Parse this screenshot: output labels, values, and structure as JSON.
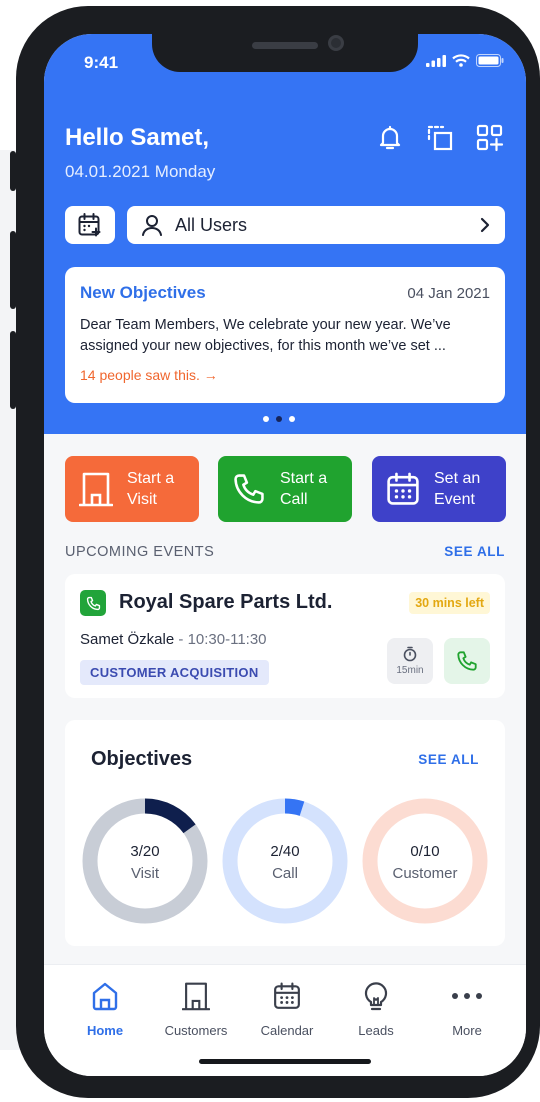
{
  "status": {
    "time": "9:41"
  },
  "header": {
    "greeting": "Hello Samet,",
    "date": "04.01.2021 Monday",
    "user_filter": "All Users"
  },
  "announcement": {
    "title": "New Objectives",
    "date": "04 Jan 2021",
    "body": "Dear Team Members, We celebrate your new year. We’ve assigned your new objectives, for this month we’ve set ...",
    "seen": "14 people saw this.",
    "carousel_pages": 3,
    "active_page": 1
  },
  "quick_actions": [
    {
      "label": "Start a Visit",
      "color": "#f56a3a",
      "icon": "building-icon"
    },
    {
      "label": "Start a Call",
      "color": "#20a32f",
      "icon": "phone-icon"
    },
    {
      "label": "Set an Event",
      "color": "#3e41c9",
      "icon": "calendar-icon"
    }
  ],
  "upcoming": {
    "heading": "UPCOMING EVENTS",
    "see_all": "SEE ALL",
    "event": {
      "title": "Royal Spare Parts Ltd.",
      "badge": "30 mins left",
      "person": "Samet Özkale",
      "time": "10:30-11:30",
      "tag": "CUSTOMER ACQUISITION",
      "timer": "15min"
    }
  },
  "objectives": {
    "title": "Objectives",
    "see_all": "SEE ALL",
    "items": [
      {
        "value": "3/20",
        "label": "Visit",
        "done": 3,
        "total": 20,
        "color": "#0f1f4d",
        "track": "#c8cdd6"
      },
      {
        "value": "2/40",
        "label": "Call",
        "done": 2,
        "total": 40,
        "color": "#3574f4",
        "track": "#d4e2fd"
      },
      {
        "value": "0/10",
        "label": "Customer",
        "done": 0,
        "total": 10,
        "color": "#f5603a",
        "track": "#fcdcd2"
      }
    ]
  },
  "tabs": [
    {
      "label": "Home",
      "icon": "home-icon",
      "active": true
    },
    {
      "label": "Customers",
      "icon": "building-icon",
      "active": false
    },
    {
      "label": "Calendar",
      "icon": "calendar-icon",
      "active": false
    },
    {
      "label": "Leads",
      "icon": "lightbulb-icon",
      "active": false
    },
    {
      "label": "More",
      "icon": "more-icon",
      "active": false
    }
  ]
}
